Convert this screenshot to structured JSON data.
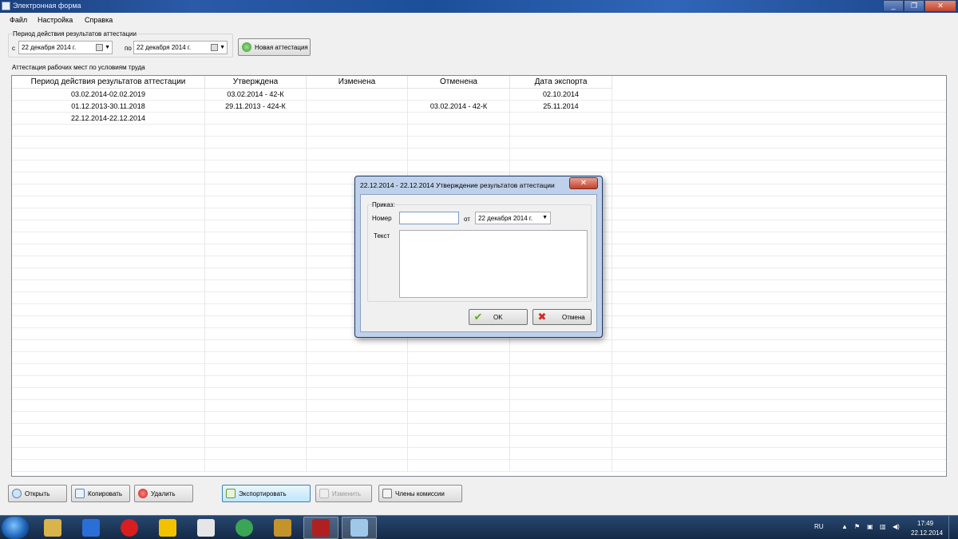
{
  "window": {
    "title": "Электронная форма",
    "controls": [
      "_",
      "❐",
      "✕"
    ]
  },
  "menu": [
    "Файл",
    "Настройка",
    "Справка"
  ],
  "period": {
    "group_title": "Период действия результатов аттестации",
    "from_label": "с",
    "from_value": "22  декабря  2014 г.",
    "to_label": "по",
    "to_value": "22 декабря  2014 г.",
    "new_button": "Новая аттестация"
  },
  "grid": {
    "group_title": "Аттестация рабочих мест по условиям труда",
    "columns": [
      "Период действия результатов аттестации",
      "Утверждена",
      "Изменена",
      "Отменена",
      "Дата экспорта"
    ],
    "rows": [
      [
        "03.02.2014-02.02.2019",
        "03.02.2014 - 42-К",
        "",
        "",
        "02.10.2014"
      ],
      [
        "01.12.2013-30.11.2018",
        "29.11.2013 - 424-К",
        "",
        "03.02.2014 - 42-К",
        "25.11.2014"
      ],
      [
        "22.12.2014-22.12.2014",
        "",
        "",
        "",
        ""
      ]
    ]
  },
  "bottom_buttons": {
    "open": "Открыть",
    "copy": "Копировать",
    "delete": "Удалить",
    "export": "Экспортировать",
    "edit": "Изменить",
    "members": "Члены комиссии"
  },
  "dialog": {
    "title": "22.12.2014 - 22.12.2014 Утверждение результатов аттестации",
    "close": "✕",
    "order_label": "Приказ:",
    "number_label": "Номер",
    "number_value": "",
    "from_label": "от",
    "date_value": "22 декабря  2014 г.",
    "text_label": "Текст",
    "text_value": "",
    "ok": "OK",
    "cancel": "Отмена"
  },
  "taskbar": {
    "language": "RU",
    "time": "17:49",
    "date": "22.12.2014",
    "apps": [
      "explorer-icon",
      "d-app-icon",
      "opera-icon",
      "triangle-app-icon",
      "cards-icon",
      "chrome-icon",
      "hon-icon",
      "red-app-icon",
      "form-app-icon"
    ]
  },
  "colors": {
    "title_bar": "#2a5aa8",
    "taskbar": "#1b3558",
    "dialog_frame": "#bfd1ea",
    "close_red": "#c4412e"
  }
}
